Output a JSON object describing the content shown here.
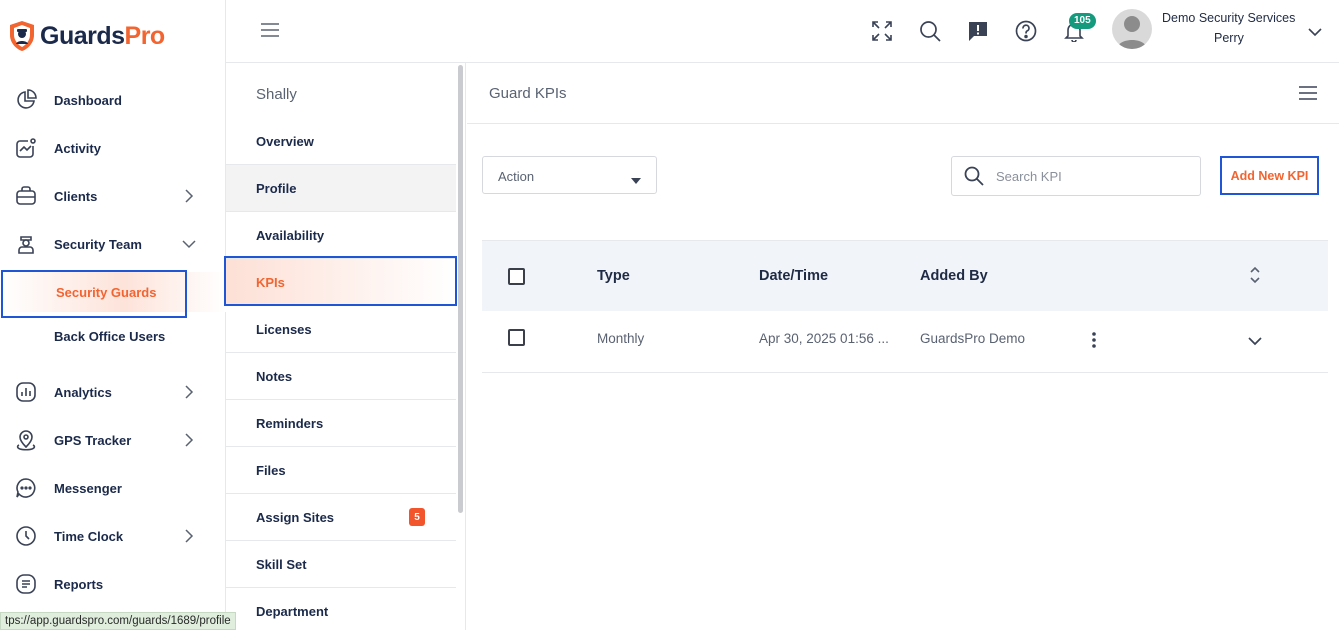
{
  "brand": {
    "name_dark": "Guards",
    "name_accent": "Pro",
    "accent_color": "#f26430",
    "dark_color": "#1b2a4a"
  },
  "sidebar": {
    "items": [
      {
        "label": "Dashboard",
        "icon": "pie-chart-icon"
      },
      {
        "label": "Activity",
        "icon": "activity-icon"
      },
      {
        "label": "Clients",
        "icon": "briefcase-icon"
      },
      {
        "label": "Security Team",
        "icon": "guard-icon"
      },
      {
        "label": "Security Guards"
      },
      {
        "label": "Back Office Users"
      },
      {
        "label": "Analytics",
        "icon": "bar-chart-icon"
      },
      {
        "label": "GPS Tracker",
        "icon": "location-pin-icon"
      },
      {
        "label": "Messenger",
        "icon": "chat-icon"
      },
      {
        "label": "Time Clock",
        "icon": "clock-icon"
      },
      {
        "label": "Reports",
        "icon": "report-icon"
      }
    ]
  },
  "topbar": {
    "notification_count": "105",
    "user_name": "Demo Security Services",
    "user_sub": "Perry"
  },
  "profile": {
    "name": "Shally",
    "menu": [
      {
        "label": "Overview"
      },
      {
        "label": "Profile"
      },
      {
        "label": "Availability"
      },
      {
        "label": "KPIs"
      },
      {
        "label": "Licenses"
      },
      {
        "label": "Notes"
      },
      {
        "label": "Reminders"
      },
      {
        "label": "Files"
      },
      {
        "label": "Assign Sites",
        "badge": "5"
      },
      {
        "label": "Skill Set"
      },
      {
        "label": "Department"
      }
    ]
  },
  "main": {
    "title": "Guard KPIs",
    "action_label": "Action",
    "search_placeholder": "Search KPI",
    "add_button": "Add New KPI",
    "columns": [
      "Type",
      "Date/Time",
      "Added By"
    ],
    "rows": [
      {
        "type": "Monthly",
        "datetime": "Apr 30, 2025 01:56 ...",
        "added_by": "GuardsPro Demo"
      }
    ]
  },
  "status_url": "tps://app.guardspro.com/guards/1689/profile"
}
